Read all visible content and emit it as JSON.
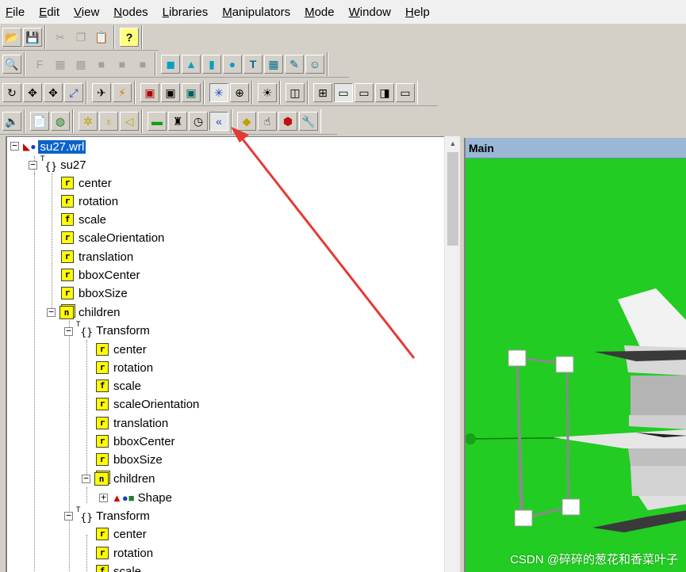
{
  "menu": [
    "File",
    "Edit",
    "View",
    "Nodes",
    "Libraries",
    "Manipulators",
    "Mode",
    "Window",
    "Help"
  ],
  "toolbar_icons": {
    "row1": [
      "open-folder-icon",
      "save-icon",
      "cut-icon",
      "copy-icon",
      "paste-icon",
      "help-question-icon"
    ],
    "row2": [
      "zoom-icon",
      "function-icon",
      "disabled-tool-icon",
      "disabled-tool-icon-2",
      "disabled-tool-icon-3",
      "disabled-tool-icon-4",
      "disabled-tool-icon-5",
      "box-icon",
      "cone-icon",
      "cylinder-icon",
      "sphere-icon",
      "text-icon",
      "grid-icon",
      "pen-icon",
      "smiley-icon"
    ],
    "row3": [
      "rotate-icon",
      "move-icon",
      "move-alt-icon",
      "scale-icon",
      "fly-icon",
      "lightning-icon",
      "view-icon-1",
      "view-icon-2",
      "view-icon-3",
      "snap-icon",
      "globe-icon",
      "light-icon",
      "layout-single-icon",
      "layout-quad-icon",
      "layout-h-icon",
      "layout-v-icon",
      "layout-3-icon",
      "layout-4-icon"
    ],
    "row4": [
      "sound-icon",
      "script-icon",
      "world-icon",
      "light-bulb-icon",
      "point-light-icon",
      "spot-light-icon",
      "color-icon",
      "lighthouse-icon",
      "timer-icon",
      "interpolator-icon",
      "proximity-icon",
      "touch-icon",
      "cube-red-icon",
      "wrench-icon"
    ]
  },
  "tree": {
    "root": "su27.wrl",
    "transform_top": "su27",
    "fields_top": [
      "center",
      "rotation",
      "scale",
      "scaleOrientation",
      "translation",
      "bboxCenter",
      "bboxSize"
    ],
    "children_label": "children",
    "transform1": "Transform",
    "fields_t1": [
      "center",
      "rotation",
      "scale",
      "scaleOrientation",
      "translation",
      "bboxCenter",
      "bboxSize"
    ],
    "children_t1": "children",
    "shape": "Shape",
    "transform2": "Transform",
    "fields_t2": [
      "center",
      "rotation",
      "scale"
    ]
  },
  "field_icon_letters": [
    "r",
    "r",
    "f",
    "r",
    "r",
    "r",
    "r"
  ],
  "main_view": {
    "title": "Main",
    "background_color": "#22cc22"
  },
  "watermark": "CSDN @碎碎的葱花和香菜叶子",
  "colors": {
    "selected": "#0a64c8",
    "arrow": "#e53935"
  }
}
